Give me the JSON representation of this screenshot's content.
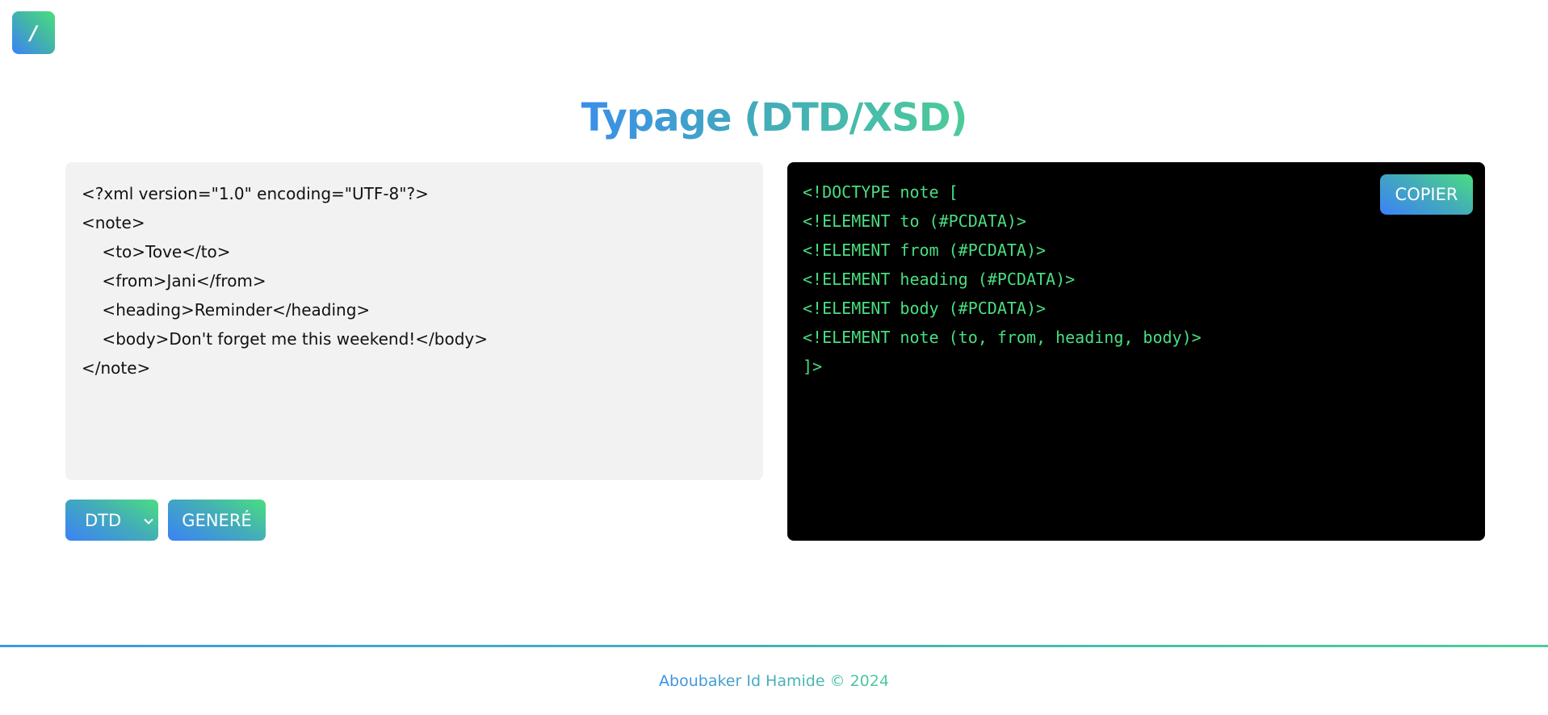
{
  "nav": {
    "home_label": "/",
    "colors": {
      "gradient_start": "#3b82f6",
      "gradient_end": "#4ade80"
    }
  },
  "header": {
    "title": "Typage (DTD/XSD)"
  },
  "input": {
    "xml_value": "<?xml version=\"1.0\" encoding=\"UTF-8\"?>\n<note>\n    <to>Tove</to>\n    <from>Jani</from>\n    <heading>Reminder</heading>\n    <body>Don't forget me this weekend!</body>\n</note>"
  },
  "controls": {
    "type_select": {
      "selected": "DTD",
      "icon": "chevron-down-icon"
    },
    "generate_label": "GENERÉ"
  },
  "output": {
    "code": "<!DOCTYPE note [\n<!ELEMENT to (#PCDATA)>\n<!ELEMENT from (#PCDATA)>\n<!ELEMENT heading (#PCDATA)>\n<!ELEMENT body (#PCDATA)>\n<!ELEMENT note (to, from, heading, body)>\n]>",
    "copy_label": "COPIER",
    "colors": {
      "background": "#000000",
      "text": "#4ade80"
    }
  },
  "footer": {
    "text": "Aboubaker Id Hamide © 2024"
  }
}
